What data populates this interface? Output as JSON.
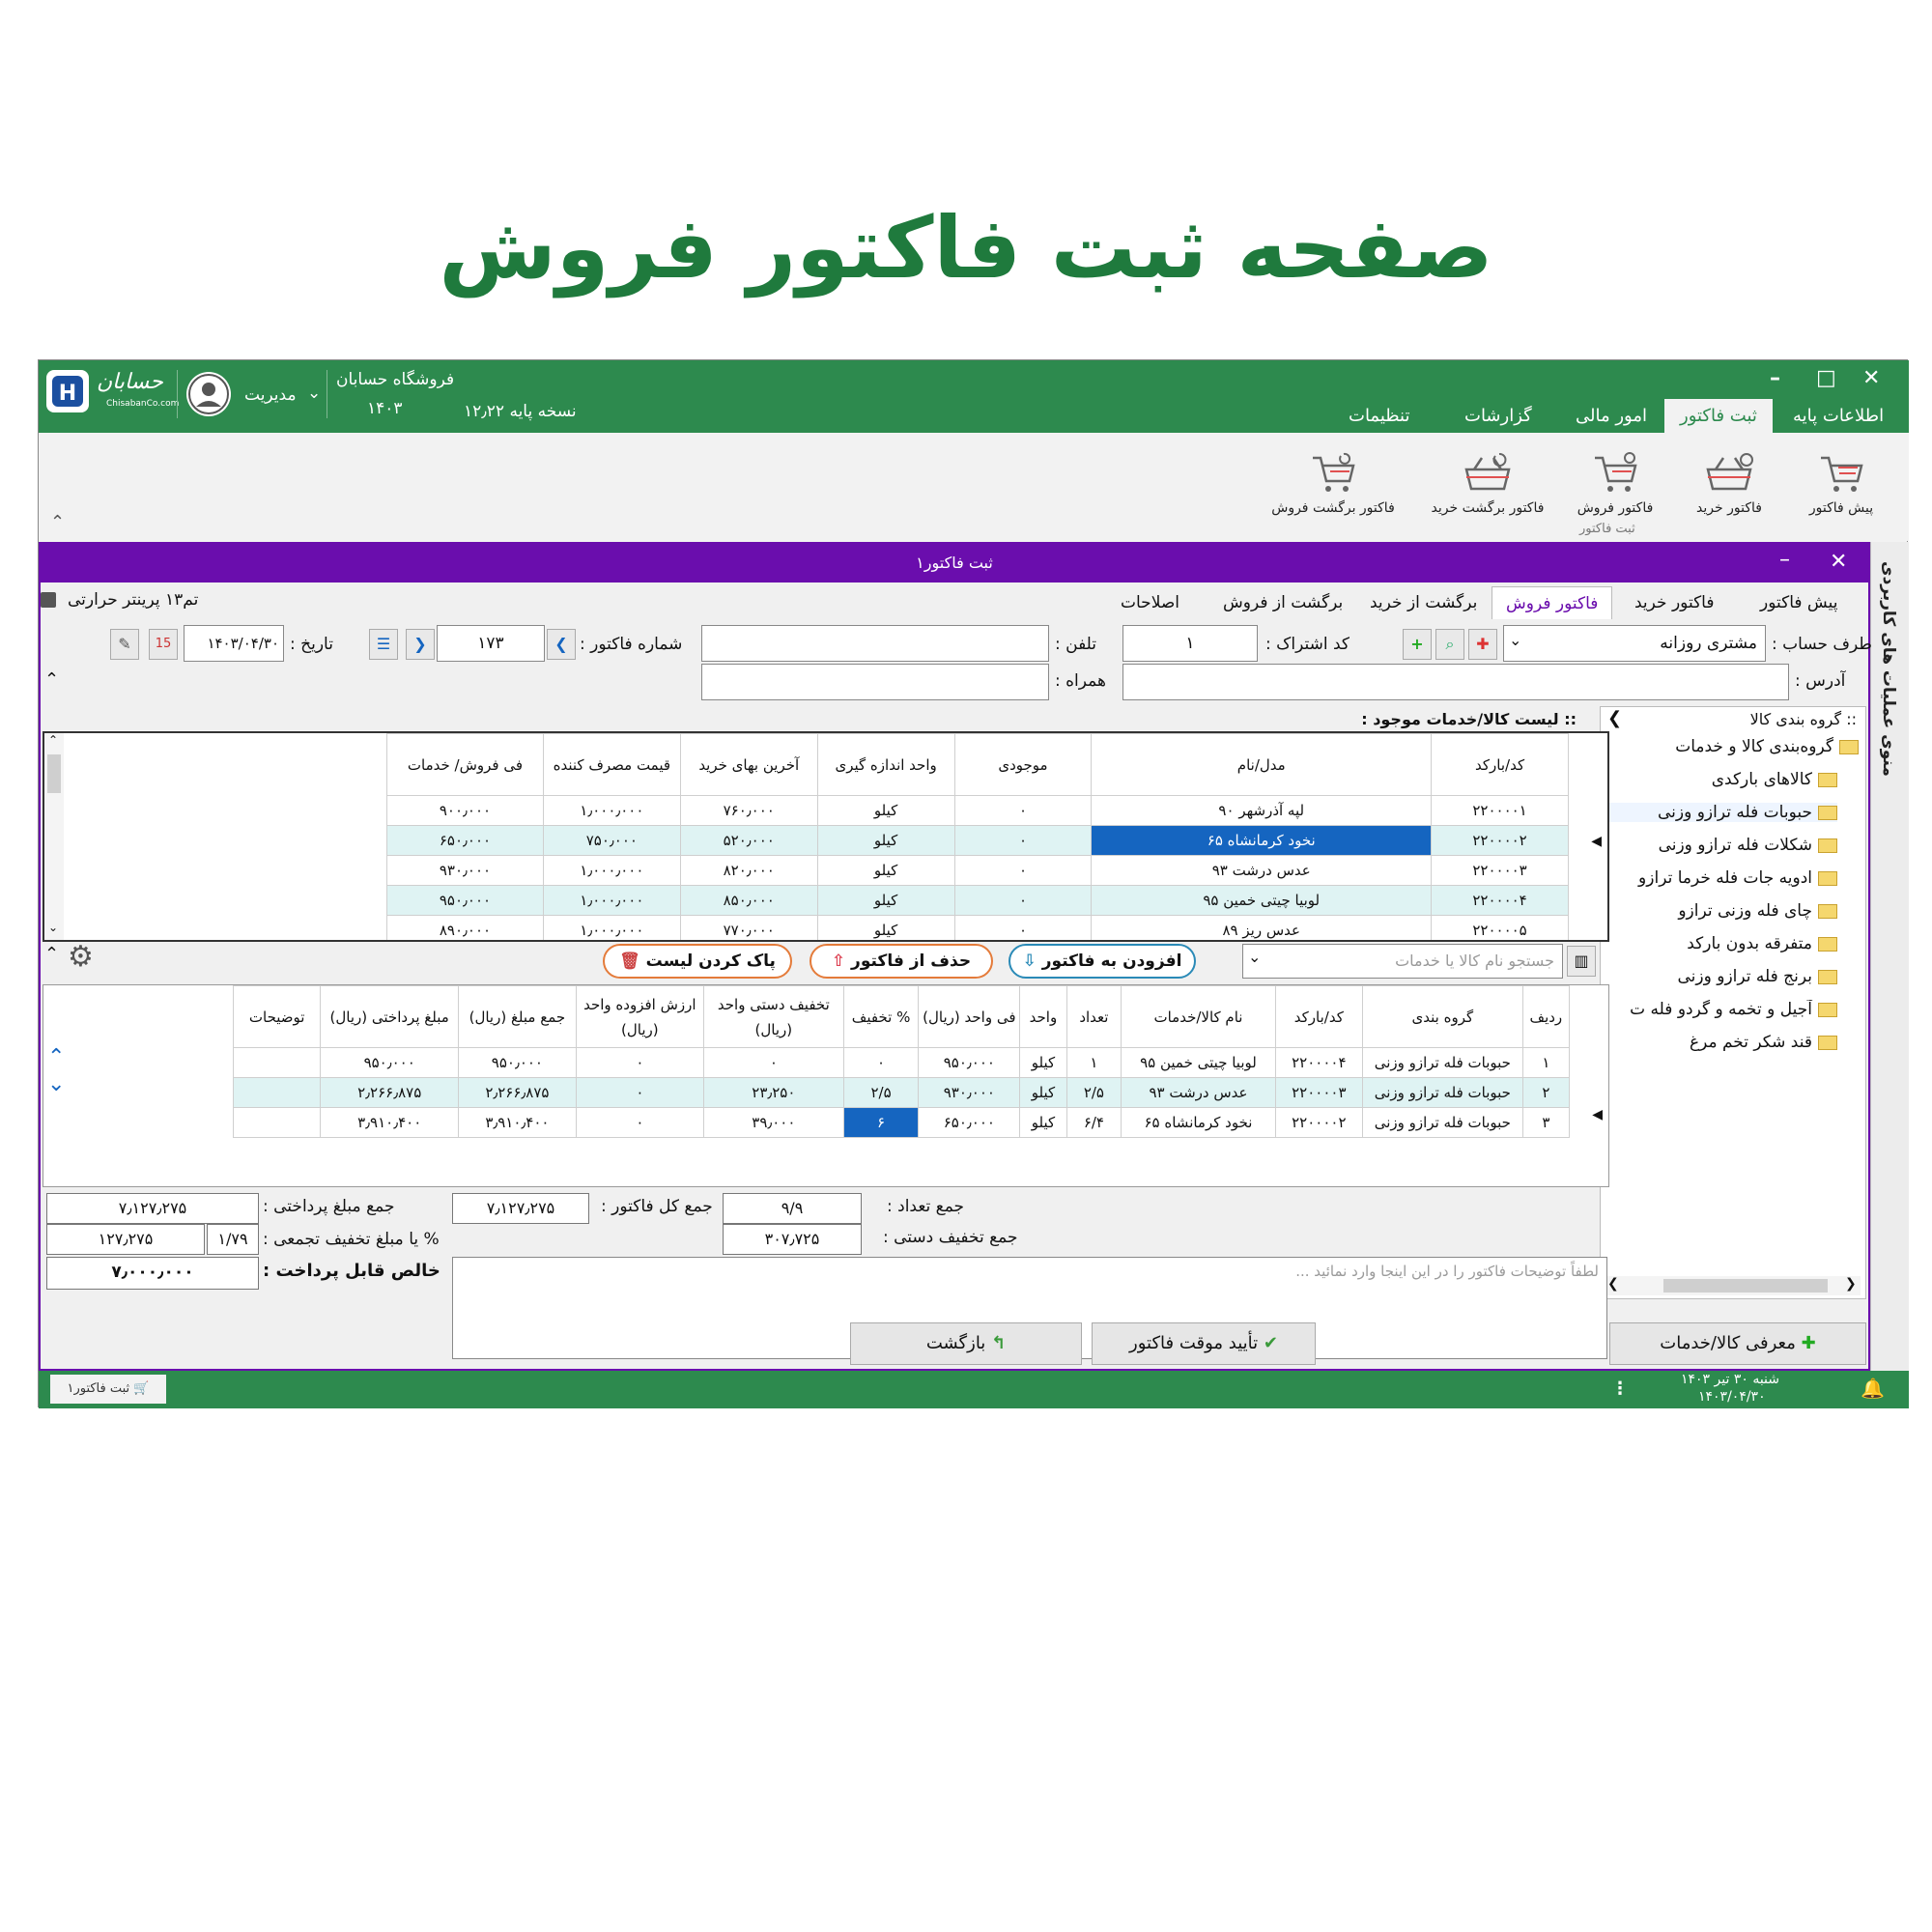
{
  "page_title": "صفحه ثبت فاکتور فروش",
  "topbar": {
    "brand": "حسابان",
    "brand_sub": "ChisabanCo.com",
    "user": "مدیریت",
    "store_name": "فروشگاه حسابان",
    "store_year": "۱۴۰۳",
    "version": "نسخه پایه ۱۲٫۲۲",
    "tabs": [
      "اطلاعات پایه",
      "ثبت فاکتور",
      "امور مالی",
      "گزارشات",
      "تنظیمات"
    ]
  },
  "ribbon": {
    "buttons": [
      "پیش فاکتور",
      "فاکتور خرید",
      "فاکتور فروش",
      "فاکتور برگشت خرید",
      "فاکتور برگشت فروش"
    ],
    "group_label": "ثبت فاکتور"
  },
  "subwindow": {
    "title": "ثبت فاکتور۱",
    "side_menu": "منوی عملیات های کاربردی",
    "printer": "تم۱۳ پرینتر حرارتی",
    "tabs": [
      "پیش فاکتور",
      "فاکتور خرید",
      "فاکتور فروش",
      "برگشت از خرید",
      "برگشت از فروش",
      "اصلاحات"
    ]
  },
  "form": {
    "account_label": "طرف حساب :",
    "account_value": "مشتری روزانه",
    "subscription_label": "کد اشتراک :",
    "subscription_value": "۱",
    "phone_label": "تلفن :",
    "phone_value": "",
    "invoice_no_label": "شماره فاکتور :",
    "invoice_no_value": "۱۷۳",
    "date_label": "تاریخ :",
    "date_value": "۱۴۰۳/۰۴/۳۰",
    "address_label": "آدرس :",
    "address_value": "",
    "mobile_label": "همراه :",
    "mobile_value": ""
  },
  "tree": {
    "header": ":: گروه بندی کالا",
    "root": "گروه‌بندی کالا و خدمات",
    "items": [
      "کالاهای بارکدی",
      "حبوبات فله ترازو وزنی",
      "شکلات فله ترازو وزنی",
      "ادویه جات فله خرما ترازو",
      "چای فله وزنی ترازو",
      "متفرقه بدون بارکد",
      "برنج فله ترازو وزنی",
      "آجیل و تخمه و گردو فله ت",
      "قند شکر تخم مرغ"
    ]
  },
  "goods": {
    "header": ":: لیست کالا/خدمات موجود :",
    "columns": [
      "کد/بارکد",
      "مدل/نام",
      "موجودی",
      "واحد اندازه گیری",
      "آخرین بهای خرید",
      "قیمت مصرف کننده",
      "فی فروش/ خدمات"
    ],
    "rows": [
      [
        "۲۲۰۰۰۰۱",
        "لپه آذرشهر ۹۰",
        "۰",
        "کیلو",
        "۷۶۰٫۰۰۰",
        "۱٫۰۰۰٫۰۰۰",
        "۹۰۰٫۰۰۰"
      ],
      [
        "۲۲۰۰۰۰۲",
        "نخود کرمانشاه ۶۵",
        "۰",
        "کیلو",
        "۵۲۰٫۰۰۰",
        "۷۵۰٫۰۰۰",
        "۶۵۰٫۰۰۰"
      ],
      [
        "۲۲۰۰۰۰۳",
        "عدس درشت ۹۳",
        "۰",
        "کیلو",
        "۸۲۰٫۰۰۰",
        "۱٫۰۰۰٫۰۰۰",
        "۹۳۰٫۰۰۰"
      ],
      [
        "۲۲۰۰۰۰۴",
        "لوبیا چیتی خمین ۹۵",
        "۰",
        "کیلو",
        "۸۵۰٫۰۰۰",
        "۱٫۰۰۰٫۰۰۰",
        "۹۵۰٫۰۰۰"
      ],
      [
        "۲۲۰۰۰۰۵",
        "عدس ریز ۸۹",
        "۰",
        "کیلو",
        "۷۷۰٫۰۰۰",
        "۱٫۰۰۰٫۰۰۰",
        "۸۹۰٫۰۰۰"
      ]
    ]
  },
  "actions": {
    "search_placeholder": "جستجو نام کالا یا خدمات",
    "add": "افزودن به فاکتور",
    "remove": "حذف از فاکتور",
    "clear": "پاک کردن لیست"
  },
  "invoice": {
    "columns": [
      "ردیف",
      "گروه بندی",
      "کد/بارکد",
      "نام کالا/خدمات",
      "تعداد",
      "واحد",
      "فی واحد (ریال)",
      "% تخفیف",
      "تخفیف دستی واحد (ریال)",
      "ارزش افزوده واحد (ریال)",
      "جمع مبلغ (ریال)",
      "مبلغ پرداختی (ریال)",
      "توضیحات"
    ],
    "rows": [
      [
        "۱",
        "حبوبات فله ترازو وزنی",
        "۲۲۰۰۰۰۴",
        "لوبیا چیتی خمین ۹۵",
        "۱",
        "کیلو",
        "۹۵۰٫۰۰۰",
        "۰",
        "۰",
        "۰",
        "۹۵۰٫۰۰۰",
        "۹۵۰٫۰۰۰",
        ""
      ],
      [
        "۲",
        "حبوبات فله ترازو وزنی",
        "۲۲۰۰۰۰۳",
        "عدس درشت ۹۳",
        "۲/۵",
        "کیلو",
        "۹۳۰٫۰۰۰",
        "۲/۵",
        "۲۳٫۲۵۰",
        "۰",
        "۲٫۲۶۶٫۸۷۵",
        "۲٫۲۶۶٫۸۷۵",
        ""
      ],
      [
        "۳",
        "حبوبات فله ترازو وزنی",
        "۲۲۰۰۰۰۲",
        "نخود کرمانشاه ۶۵",
        "۶/۴",
        "کیلو",
        "۶۵۰٫۰۰۰",
        "۶",
        "۳۹٫۰۰۰",
        "۰",
        "۳٫۹۱۰٫۴۰۰",
        "۳٫۹۱۰٫۴۰۰",
        ""
      ]
    ]
  },
  "totals": {
    "count_label": "جمع تعداد :",
    "count_value": "۹/۹",
    "manual_disc_label": "جمع تخفیف دستی :",
    "manual_disc_value": "۳۰۷٫۷۲۵",
    "invoice_total_label": "جمع کل فاکتور :",
    "invoice_total_value": "۷٫۱۲۷٫۲۷۵",
    "paid_total_label": "جمع مبلغ پرداختی :",
    "paid_total_value": "۷٫۱۲۷٫۲۷۵",
    "group_disc_label": "% یا مبلغ تخفیف تجمعی :",
    "group_disc_pct": "۱/۷۹",
    "group_disc_value": "۱۲۷٫۲۷۵",
    "net_label": "خالص قابل پرداخت :",
    "net_value": "۷٫۰۰۰٫۰۰۰",
    "notes_placeholder": "لطفاً توضیحات فاکتور را در این اینجا وارد نمائید ..."
  },
  "buttons": {
    "confirm": "تأیید موقت فاکتور",
    "back": "بازگشت",
    "introduce": "معرفی کالا/خدمات"
  },
  "statusbar": {
    "taskbar_item": "ثبت فاکتور۱",
    "day": "شنبه ۳۰ تیر ۱۴۰۳",
    "date": "۱۴۰۳/۰۴/۳۰"
  },
  "colors": {
    "title_green": "#1f7a3d",
    "app_green": "#2d8a4e",
    "purple": "#6a0dad",
    "selection_blue": "#1565c0",
    "row_alt": "#dff3f3"
  }
}
